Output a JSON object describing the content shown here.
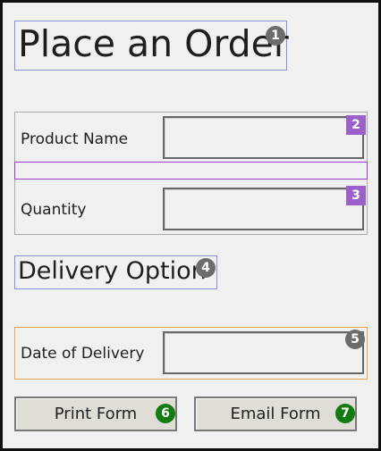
{
  "form": {
    "title": "Place an Order",
    "fields": {
      "product_name": {
        "label": "Product Name",
        "value": ""
      },
      "quantity": {
        "label": "Quantity",
        "value": ""
      },
      "date_of_delivery": {
        "label": "Date of Delivery",
        "value": ""
      }
    },
    "section_title": "Delivery Option",
    "buttons": {
      "print": "Print Form",
      "email": "Email Form"
    }
  },
  "badges": [
    "1",
    "2",
    "3",
    "4",
    "5",
    "6",
    "7"
  ],
  "colors": {
    "background": "#f0f0f0",
    "frame_border": "#111111",
    "title_outline": "#8c8cdc",
    "group_outline": "#a9a9a9",
    "purple_outline": "#a03ccd",
    "date_outline": "#e8a251",
    "badge_gray": "#6c6c6c",
    "badge_purple": "#9b61c9",
    "badge_green": "#127c12",
    "button_face": "#e0dcd6"
  }
}
